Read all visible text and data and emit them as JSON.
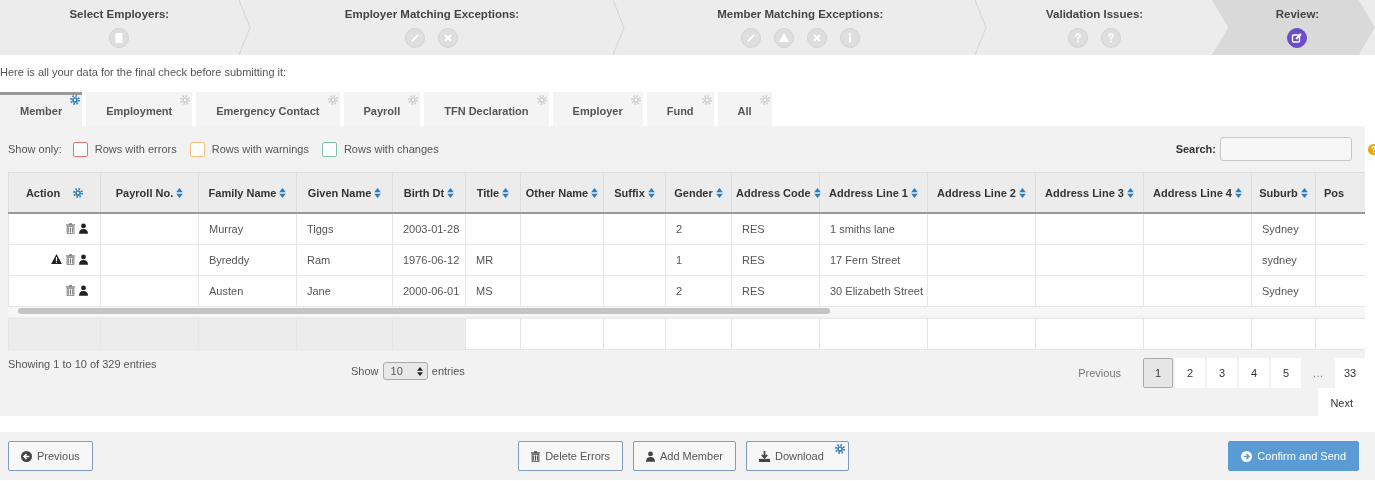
{
  "wizard": {
    "steps": [
      {
        "title": "Select Employers:",
        "selected": false,
        "icons": [
          {
            "kind": "document"
          }
        ]
      },
      {
        "title": "Employer Matching Exceptions:",
        "selected": false,
        "icons": [
          {
            "kind": "pencil"
          },
          {
            "kind": "times"
          }
        ]
      },
      {
        "title": "Member Matching Exceptions:",
        "selected": false,
        "icons": [
          {
            "kind": "pencil"
          },
          {
            "kind": "warning"
          },
          {
            "kind": "times"
          },
          {
            "kind": "info"
          }
        ]
      },
      {
        "title": "Validation Issues:",
        "selected": false,
        "icons": [
          {
            "kind": "question"
          },
          {
            "kind": "question"
          }
        ]
      },
      {
        "title": "Review:",
        "selected": true,
        "icons": [
          {
            "kind": "edit"
          }
        ]
      }
    ]
  },
  "intro": "Here is all your data for the final check before submitting it:",
  "tabs": [
    {
      "label": "Member",
      "selected": true
    },
    {
      "label": "Employment",
      "selected": false
    },
    {
      "label": "Emergency Contact",
      "selected": false
    },
    {
      "label": "Payroll",
      "selected": false
    },
    {
      "label": "TFN Declaration",
      "selected": false
    },
    {
      "label": "Employer",
      "selected": false
    },
    {
      "label": "Fund",
      "selected": false
    },
    {
      "label": "All",
      "selected": false
    }
  ],
  "filters": {
    "label": "Show only:",
    "options": [
      {
        "label": "Rows with errors",
        "color": "#e57373",
        "checked": false
      },
      {
        "label": "Rows with warnings",
        "color": "#f5c07a",
        "checked": false
      },
      {
        "label": "Rows with changes",
        "color": "#7fbfa8",
        "checked": false
      }
    ]
  },
  "search": {
    "label": "Search:"
  },
  "table": {
    "columns": [
      {
        "label": "Action",
        "kind": "action"
      },
      {
        "label": "Payroll No.",
        "kind": "sortable"
      },
      {
        "label": "Family Name",
        "kind": "sortable"
      },
      {
        "label": "Given Name",
        "kind": "sortable"
      },
      {
        "label": "Birth Dt",
        "kind": "sortable"
      },
      {
        "label": "Title",
        "kind": "sortable"
      },
      {
        "label": "Other Name",
        "kind": "sortable"
      },
      {
        "label": "Suffix",
        "kind": "sortable"
      },
      {
        "label": "Gender",
        "kind": "sortable"
      },
      {
        "label": "Address Code",
        "kind": "sortable"
      },
      {
        "label": "Address Line 1",
        "kind": "sortable"
      },
      {
        "label": "Address Line 2",
        "kind": "sortable"
      },
      {
        "label": "Address Line 3",
        "kind": "sortable"
      },
      {
        "label": "Address Line 4",
        "kind": "sortable"
      },
      {
        "label": "Suburb",
        "kind": "sortable"
      },
      {
        "label": "Pos",
        "kind": "plain"
      }
    ],
    "rows": [
      {
        "actions": [
          {
            "kind": "trash"
          },
          {
            "kind": "user"
          }
        ],
        "cells": [
          "",
          "",
          "Murray",
          "Tiggs",
          "2003-01-28",
          "",
          "",
          "",
          "2",
          "RES",
          "1 smiths lane",
          "",
          "",
          "",
          "Sydney",
          ""
        ]
      },
      {
        "actions": [
          {
            "kind": "warning"
          },
          {
            "kind": "trash"
          },
          {
            "kind": "user"
          }
        ],
        "cells": [
          "",
          "",
          "Byreddy",
          "Ram",
          "1976-06-12",
          "MR",
          "",
          "",
          "1",
          "RES",
          "17 Fern Street",
          "",
          "",
          "",
          "sydney",
          ""
        ]
      },
      {
        "actions": [
          {
            "kind": "trash"
          },
          {
            "kind": "user"
          }
        ],
        "cells": [
          "",
          "",
          "Austen",
          "Jane",
          "2000-06-01",
          "MS",
          "",
          "",
          "2",
          "RES",
          "30 Elizabeth Street",
          "",
          "",
          "",
          "Sydney",
          ""
        ]
      }
    ]
  },
  "info": "Showing 1 to 10 of 329 entries",
  "length": {
    "before": "Show",
    "value": "10",
    "after": "entries"
  },
  "pagination": {
    "previous": {
      "label": "Previous",
      "disabled": true
    },
    "pages": [
      {
        "label": "1",
        "kind": "page",
        "selected": true
      },
      {
        "label": "2",
        "kind": "page",
        "selected": false
      },
      {
        "label": "3",
        "kind": "page",
        "selected": false
      },
      {
        "label": "4",
        "kind": "page",
        "selected": false
      },
      {
        "label": "5",
        "kind": "page",
        "selected": false
      },
      {
        "label": "…",
        "kind": "ellipsis"
      },
      {
        "label": "33",
        "kind": "page",
        "selected": false
      }
    ],
    "next": {
      "label": "Next",
      "disabled": false
    }
  },
  "actions": [
    {
      "label": "Previous",
      "kind": "circle-left",
      "primary": false,
      "settings": false
    },
    {
      "label": "Delete Errors",
      "kind": "trash",
      "primary": false,
      "settings": false
    },
    {
      "label": "Add Member",
      "kind": "user",
      "primary": false,
      "settings": false
    },
    {
      "label": "Download",
      "kind": "download",
      "primary": false,
      "settings": true
    },
    {
      "label": "Confirm and Send",
      "kind": "circle-right",
      "primary": true,
      "settings": false
    }
  ]
}
